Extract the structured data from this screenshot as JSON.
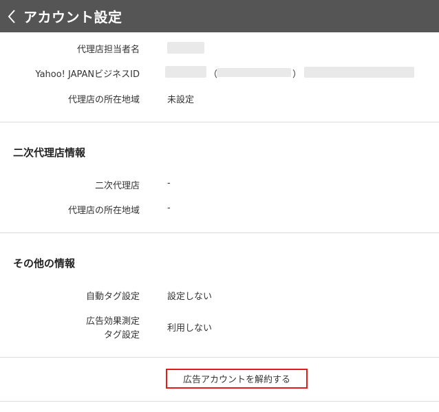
{
  "header": {
    "title": "アカウント設定",
    "back_icon": "chevron-left-icon"
  },
  "agency": {
    "rep_label": "代理店担当者名",
    "yahoo_id_label": "Yahoo! JAPANビジネスID",
    "paren_open": "（",
    "paren_close": "）",
    "region_label": "代理店の所在地域",
    "region_value": "未設定"
  },
  "secondary_agency": {
    "section_title": "二次代理店情報",
    "name_label": "二次代理店",
    "name_value": "-",
    "region_label": "代理店の所在地域",
    "region_value": "-"
  },
  "other_info": {
    "section_title": "その他の情報",
    "auto_tag_label": "自動タグ設定",
    "auto_tag_value": "設定しない",
    "measure_tag_label_line1": "広告効果測定",
    "measure_tag_label_line2": "タグ設定",
    "measure_tag_value": "利用しない"
  },
  "actions": {
    "cancel_account_label": "広告アカウントを解約する"
  },
  "colors": {
    "header_bg": "#555555",
    "button_border": "#e21b1b"
  }
}
